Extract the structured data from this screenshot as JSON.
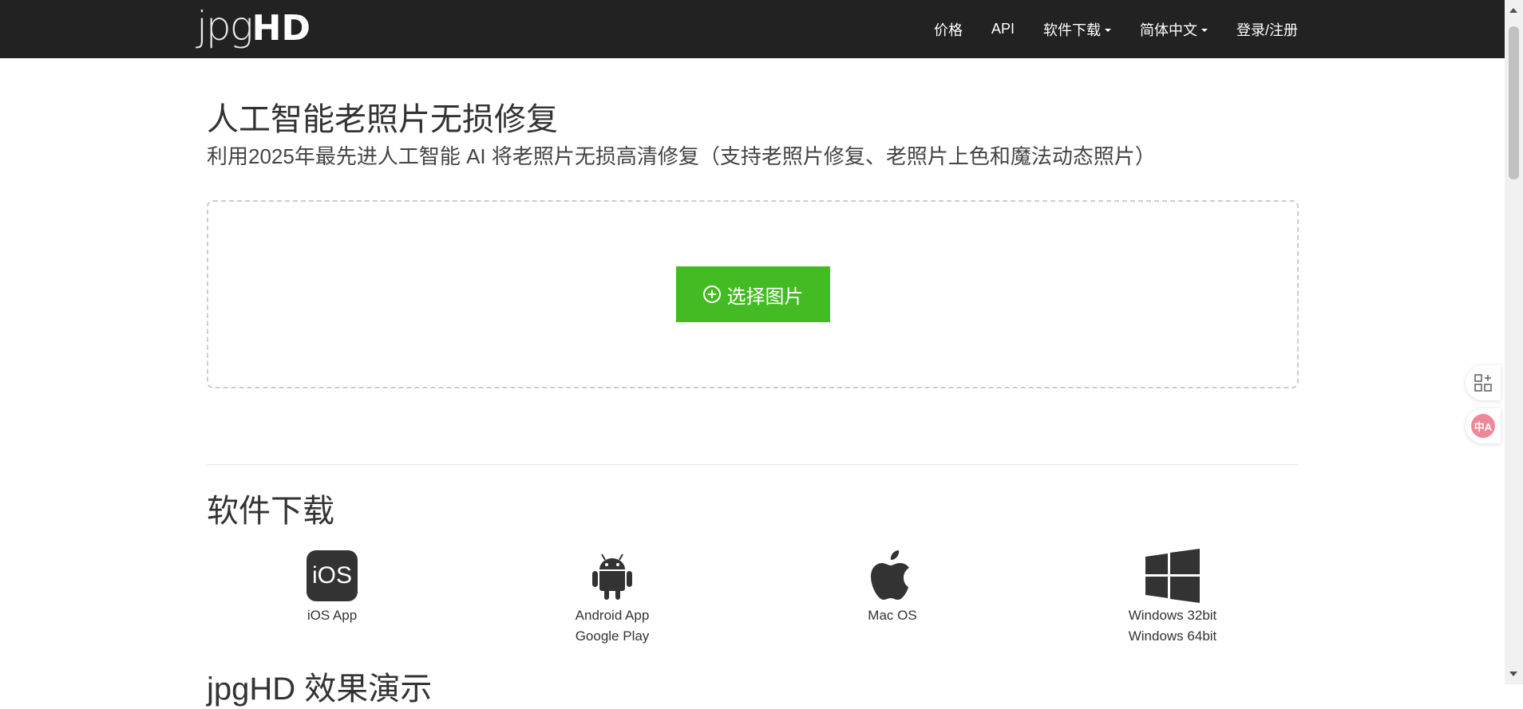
{
  "header": {
    "logo_light": "jpg",
    "logo_bold": "HD",
    "nav": {
      "price": "价格",
      "api": "API",
      "download": "软件下载",
      "language": "简体中文",
      "login": "登录/注册"
    }
  },
  "hero": {
    "title": "人工智能老照片无损修复",
    "subtitle": "利用2025年最先进人工智能 AI 将老照片无损高清修复（支持老照片修复、老照片上色和魔法动态照片）",
    "upload_button": "选择图片"
  },
  "downloads": {
    "title": "软件下载",
    "items": [
      {
        "icon": "ios-icon",
        "icon_text": "iOS",
        "line1": "iOS App",
        "line2": ""
      },
      {
        "icon": "android-icon",
        "line1": "Android App",
        "line2": "Google Play"
      },
      {
        "icon": "apple-icon",
        "line1": "Mac OS",
        "line2": ""
      },
      {
        "icon": "windows-icon",
        "line1": "Windows 32bit",
        "line2": "Windows 64bit"
      }
    ]
  },
  "next_section": {
    "title": "jpgHD 效果演示"
  },
  "floating": {
    "translate_badge": "中A"
  },
  "colors": {
    "navbar_bg": "#222222",
    "primary_green": "#44bb22",
    "text": "#333333"
  }
}
